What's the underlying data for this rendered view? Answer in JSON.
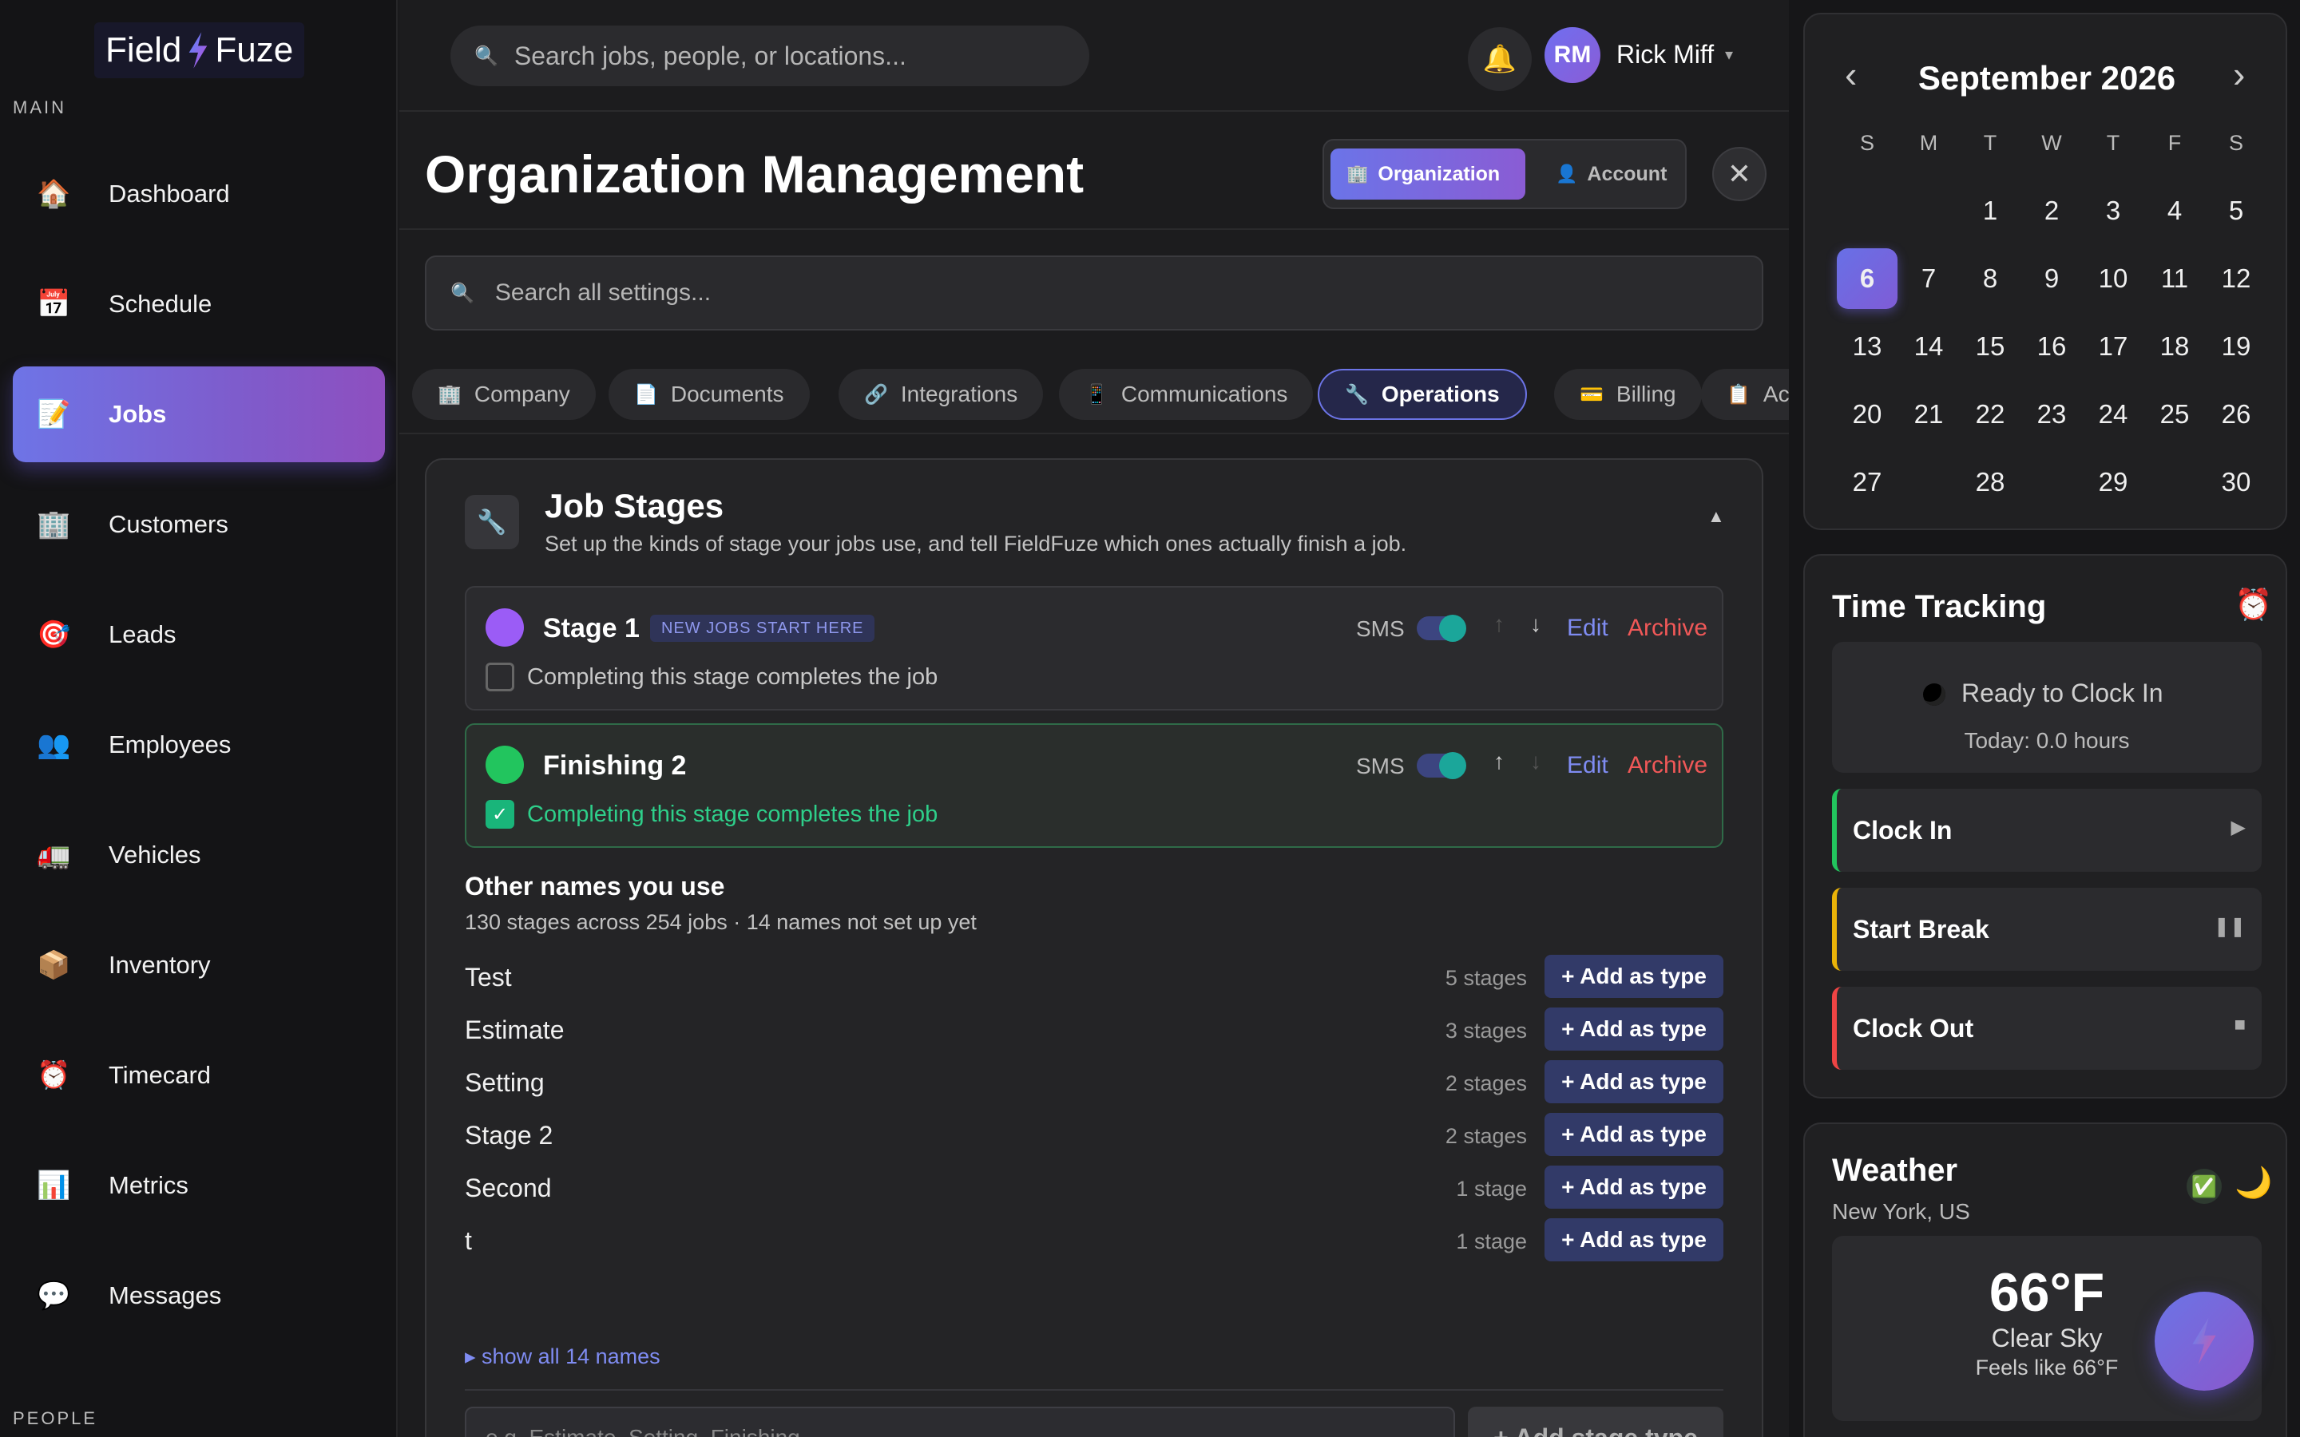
{
  "brand": {
    "part1": "Field",
    "part2": "Fuze"
  },
  "sidebar": {
    "section_main": "MAIN",
    "section_people": "PEOPLE",
    "items": [
      {
        "label": "Dashboard",
        "icon": "🏠",
        "icon_name": "house-icon",
        "active": false
      },
      {
        "label": "Schedule",
        "icon": "📅",
        "icon_name": "calendar-icon",
        "active": false
      },
      {
        "label": "Jobs",
        "icon": "📝",
        "icon_name": "memo-icon",
        "active": true
      },
      {
        "label": "Customers",
        "icon": "🏢",
        "icon_name": "building-icon",
        "active": false
      },
      {
        "label": "Leads",
        "icon": "🎯",
        "icon_name": "target-icon",
        "active": false
      },
      {
        "label": "Employees",
        "icon": "👥",
        "icon_name": "people-icon",
        "active": false
      },
      {
        "label": "Vehicles",
        "icon": "🚛",
        "icon_name": "truck-icon",
        "active": false
      },
      {
        "label": "Inventory",
        "icon": "📦",
        "icon_name": "package-icon",
        "active": false
      },
      {
        "label": "Timecard",
        "icon": "⏰",
        "icon_name": "alarm-clock-icon",
        "active": false
      },
      {
        "label": "Metrics",
        "icon": "📊",
        "icon_name": "bar-chart-icon",
        "active": false
      },
      {
        "label": "Messages",
        "icon": "💬",
        "icon_name": "speech-bubble-icon",
        "active": false
      }
    ]
  },
  "topbar": {
    "search_placeholder": "Search jobs, people, or locations...",
    "bell_icon": "🔔",
    "user_initials": "RM",
    "user_name": "Rick Miff",
    "caret": "▾"
  },
  "main": {
    "title": "Organization Management",
    "segment": {
      "organization": "Organization",
      "account": "Account",
      "org_icon": "🏢",
      "acct_icon": "👤"
    },
    "close_glyph": "✕",
    "settings_search_placeholder": "Search all settings...",
    "tabs": [
      {
        "label": "Company",
        "icon": "🏢",
        "active": false
      },
      {
        "label": "Documents",
        "icon": "📄",
        "active": false
      },
      {
        "label": "Integrations",
        "icon": "🔗",
        "active": false
      },
      {
        "label": "Communications",
        "icon": "📱",
        "active": false
      },
      {
        "label": "Operations",
        "icon": "🔧",
        "active": true
      },
      {
        "label": "Billing",
        "icon": "💳",
        "active": false
      },
      {
        "label": "Ac",
        "icon": "📋",
        "active": false
      }
    ]
  },
  "job_stages": {
    "icon": "🔧",
    "title": "Job Stages",
    "subtitle": "Set up the kinds of stage your jobs use, and tell FieldFuze which ones actually finish a job.",
    "collapse_glyph": "▲",
    "stages": [
      {
        "name": "Stage 1",
        "badge": "NEW JOBS START HERE",
        "color": "#9b5cf6",
        "sms_label": "SMS",
        "sms_on": true,
        "completes_job": false,
        "complete_label": "Completing this stage completes the job",
        "edit": "Edit",
        "archive": "Archive"
      },
      {
        "name": "Finishing 2",
        "badge": "",
        "color": "#22c55e",
        "sms_label": "SMS",
        "sms_on": true,
        "completes_job": true,
        "complete_label": "Completing this stage completes the job",
        "edit": "Edit",
        "archive": "Archive"
      }
    ],
    "other_names_title": "Other names you use",
    "other_names_sub": "130 stages across 254 jobs · 14 names not set up yet",
    "other_names": [
      {
        "name": "Test",
        "count": "5 stages"
      },
      {
        "name": "Estimate",
        "count": "3 stages"
      },
      {
        "name": "Setting",
        "count": "2 stages"
      },
      {
        "name": "Stage 2",
        "count": "2 stages"
      },
      {
        "name": "Second",
        "count": "1 stage"
      },
      {
        "name": "t",
        "count": "1 stage"
      }
    ],
    "add_as_type_label": "+ Add as type",
    "show_all": "▸ show all 14 names",
    "new_stage_placeholder": "e.g. Estimate, Setting, Finishing",
    "add_stage_button": "+ Add stage type"
  },
  "calendar": {
    "month_label": "September 2026",
    "prev": "‹",
    "next": "›",
    "weekdays": [
      "S",
      "M",
      "T",
      "W",
      "T",
      "F",
      "S"
    ],
    "weeks": [
      [
        "",
        "",
        "1",
        "2",
        "3",
        "4",
        "5"
      ],
      [
        "6",
        "7",
        "8",
        "9",
        "10",
        "11",
        "12"
      ],
      [
        "13",
        "14",
        "15",
        "16",
        "17",
        "18",
        "19"
      ],
      [
        "20",
        "21",
        "22",
        "23",
        "24",
        "25",
        "26"
      ],
      [
        "27",
        "28",
        "29",
        "30"
      ]
    ],
    "today": "6"
  },
  "time_tracking": {
    "title": "Time Tracking",
    "alarm_icon": "⏰",
    "status": "Ready to Clock In",
    "today_hours": "Today: 0.0 hours",
    "buttons": [
      {
        "label": "Clock In",
        "glyph": "▶",
        "accent": "#22c55e"
      },
      {
        "label": "Start Break",
        "glyph": "❚❚",
        "accent": "#eab308"
      },
      {
        "label": "Clock Out",
        "glyph": "■",
        "accent": "#ef4444"
      }
    ]
  },
  "weather": {
    "title": "Weather",
    "location": "New York, US",
    "check_icon": "✅",
    "moon_icon": "🌙",
    "temperature": "66°F",
    "condition": "Clear Sky",
    "feels_like": "Feels like 66°F"
  },
  "colors": {
    "accent": "#6c74e6",
    "accent2": "#8a5cd4",
    "danger": "#f05858",
    "link": "#7f8cf2",
    "success": "#2ecf8a"
  }
}
